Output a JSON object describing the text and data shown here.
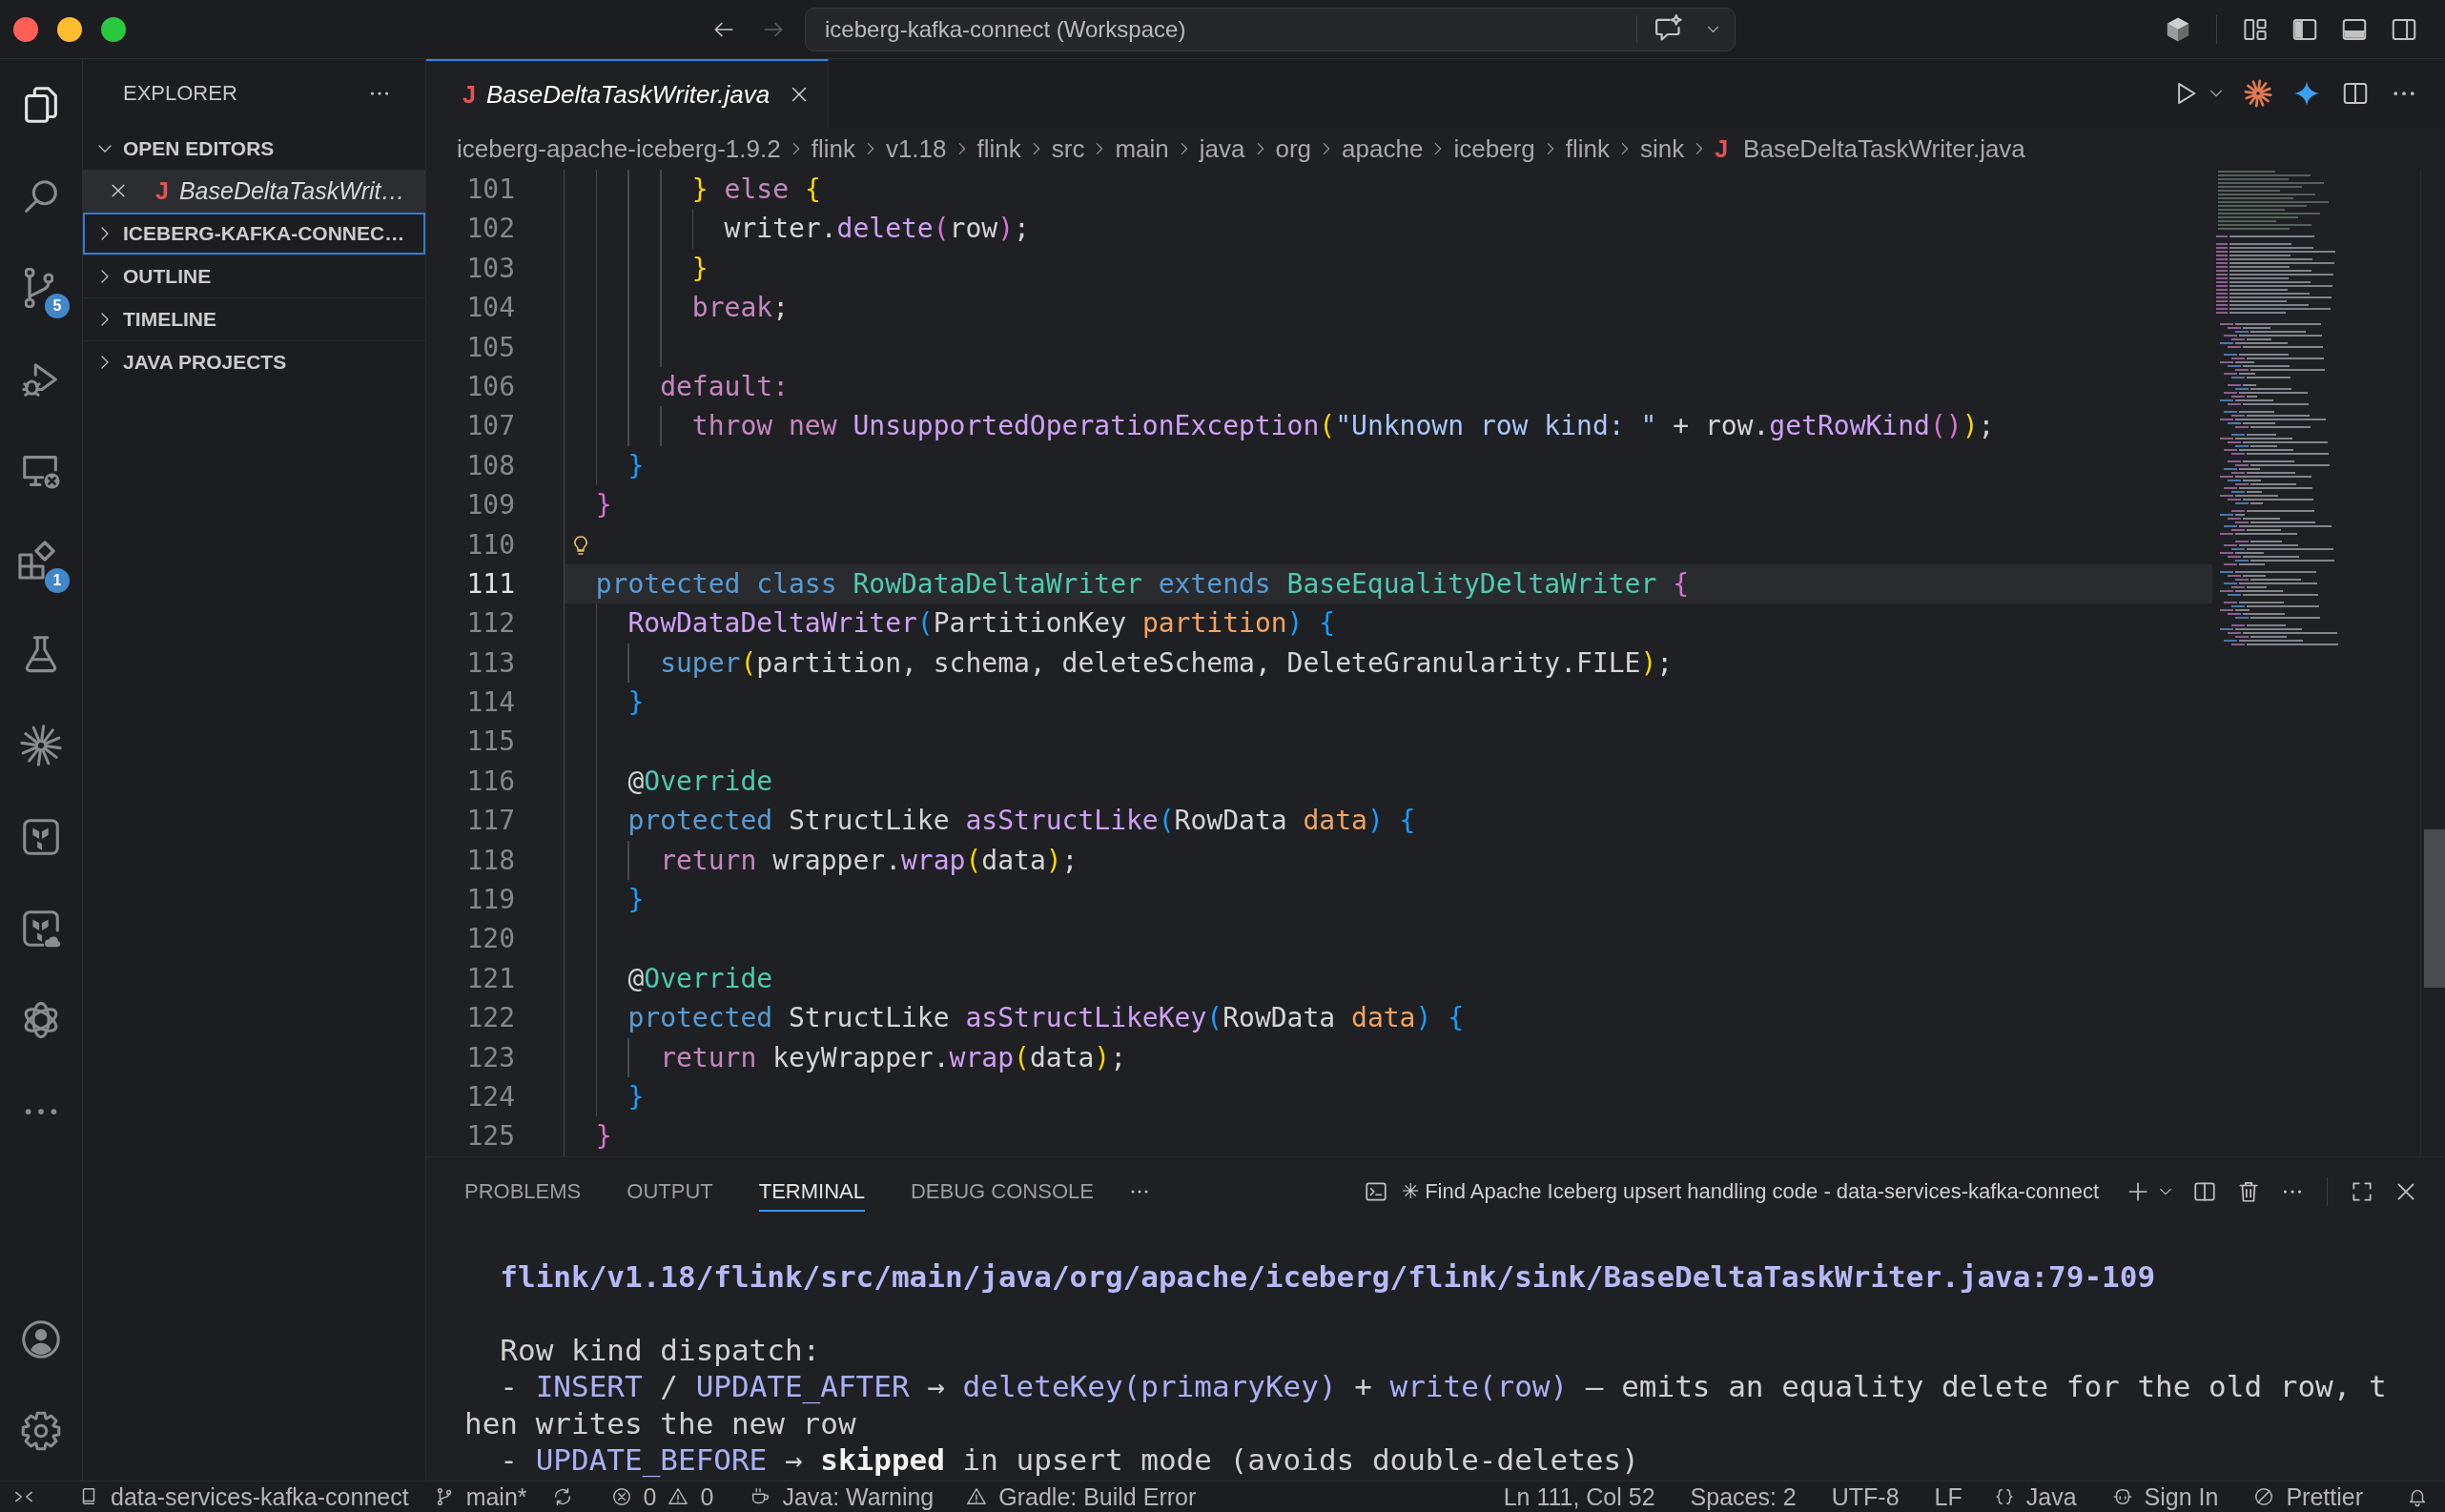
{
  "title_bar": {
    "navigation": {
      "back": {
        "disabled": false
      },
      "forward": {
        "disabled": true
      }
    },
    "command_center": "iceberg-kafka-connect (Workspace)",
    "layout_toggles": [
      {
        "on": true
      },
      {
        "on": true
      },
      {
        "on": false
      }
    ]
  },
  "activity_bar": {
    "items": [
      {
        "selected": true
      },
      {
        "selected": false
      },
      {
        "selected": false,
        "badge": "5"
      },
      {
        "selected": false
      },
      {
        "selected": false
      },
      {
        "selected": false,
        "badge": "1"
      },
      {
        "selected": false
      },
      {
        "selected": false
      },
      {
        "selected": false
      },
      {
        "selected": false
      },
      {
        "selected": false
      }
    ]
  },
  "sidebar": {
    "title": "EXPLORER",
    "sections": [
      {
        "label": "OPEN EDITORS",
        "expanded": true,
        "focused": false,
        "items": [
          {
            "icon": "J",
            "label": "BaseDeltaTaskWrit…",
            "selected": true,
            "preview": true
          }
        ]
      },
      {
        "label": "ICEBERG-KAFKA-CONNEC…",
        "expanded": false,
        "focused": true
      },
      {
        "label": "OUTLINE",
        "expanded": false,
        "focused": false
      },
      {
        "label": "TIMELINE",
        "expanded": false,
        "focused": false
      },
      {
        "label": "JAVA PROJECTS",
        "expanded": false,
        "focused": false
      }
    ]
  },
  "editor": {
    "tabs": [
      {
        "icon": "J",
        "label": "BaseDeltaTaskWriter.java",
        "selected": true,
        "preview": true
      }
    ],
    "breadcrumb": {
      "folders": [
        "iceberg-apache-iceberg-1.9.2",
        "flink",
        "v1.18",
        "flink",
        "src",
        "main",
        "java",
        "org",
        "apache",
        "iceberg",
        "flink",
        "sink"
      ],
      "file": {
        "icon": "J",
        "label": "BaseDeltaTaskWriter.java"
      }
    },
    "lines": [
      {
        "number": "101",
        "current": false,
        "lightbulb": false,
        "tokens": [
          {
            "text": "        }",
            "kind": "bracket1"
          },
          {
            "text": " else ",
            "kind": "control"
          },
          {
            "text": "{",
            "kind": "bracket1"
          }
        ]
      },
      {
        "number": "102",
        "current": false,
        "lightbulb": false,
        "tokens": [
          {
            "text": "          writer.",
            "kind": "plain"
          },
          {
            "text": "delete",
            "kind": "function"
          },
          {
            "text": "(",
            "kind": "bracket2"
          },
          {
            "text": "row",
            "kind": "plain"
          },
          {
            "text": ")",
            "kind": "bracket2"
          },
          {
            "text": ";",
            "kind": "plain"
          }
        ]
      },
      {
        "number": "103",
        "current": false,
        "lightbulb": false,
        "tokens": [
          {
            "text": "        }",
            "kind": "bracket1"
          }
        ]
      },
      {
        "number": "104",
        "current": false,
        "lightbulb": false,
        "tokens": [
          {
            "text": "        break",
            "kind": "control"
          },
          {
            "text": ";",
            "kind": "plain"
          }
        ]
      },
      {
        "number": "105",
        "current": false,
        "lightbulb": false
      },
      {
        "number": "106",
        "current": false,
        "lightbulb": false,
        "tokens": [
          {
            "text": "      default:",
            "kind": "control"
          }
        ]
      },
      {
        "number": "107",
        "current": false,
        "lightbulb": false,
        "tokens": [
          {
            "text": "        throw new ",
            "kind": "control"
          },
          {
            "text": "UnsupportedOperationException",
            "kind": "function"
          },
          {
            "text": "(",
            "kind": "bracket1"
          },
          {
            "text": "\"Unknown row kind: \"",
            "kind": "string"
          },
          {
            "text": " + row.",
            "kind": "plain"
          },
          {
            "text": "getRowKind",
            "kind": "function"
          },
          {
            "text": "()",
            "kind": "bracket2"
          },
          {
            "text": ")",
            "kind": "bracket1"
          },
          {
            "text": ";",
            "kind": "plain"
          }
        ]
      },
      {
        "number": "108",
        "current": false,
        "lightbulb": false,
        "tokens": [
          {
            "text": "    }",
            "kind": "bracket3"
          }
        ]
      },
      {
        "number": "109",
        "current": false,
        "lightbulb": false,
        "tokens": [
          {
            "text": "  }",
            "kind": "bracket2"
          }
        ]
      },
      {
        "number": "110",
        "current": false,
        "lightbulb": true
      },
      {
        "number": "111",
        "current": true,
        "lightbulb": false,
        "tokens": [
          {
            "text": "  protected class ",
            "kind": "keyword"
          },
          {
            "text": "RowDataDeltaWriter",
            "kind": "type"
          },
          {
            "text": " extends ",
            "kind": "keyword"
          },
          {
            "text": "BaseEqualityDeltaWriter",
            "kind": "type"
          },
          {
            "text": " {",
            "kind": "bracket2"
          }
        ]
      },
      {
        "number": "112",
        "current": false,
        "lightbulb": false,
        "tokens": [
          {
            "text": "    RowDataDeltaWriter",
            "kind": "function"
          },
          {
            "text": "(",
            "kind": "bracket3"
          },
          {
            "text": "PartitionKey ",
            "kind": "plain"
          },
          {
            "text": "partition",
            "kind": "param"
          },
          {
            "text": ") {",
            "kind": "bracket3"
          }
        ]
      },
      {
        "number": "113",
        "current": false,
        "lightbulb": false,
        "tokens": [
          {
            "text": "      super",
            "kind": "keyword"
          },
          {
            "text": "(",
            "kind": "bracket1"
          },
          {
            "text": "partition, schema, deleteSchema, DeleteGranularity.FILE",
            "kind": "plain"
          },
          {
            "text": ")",
            "kind": "bracket1"
          },
          {
            "text": ";",
            "kind": "plain"
          }
        ]
      },
      {
        "number": "114",
        "current": false,
        "lightbulb": false,
        "tokens": [
          {
            "text": "    }",
            "kind": "bracket3"
          }
        ]
      },
      {
        "number": "115",
        "current": false,
        "lightbulb": false
      },
      {
        "number": "116",
        "current": false,
        "lightbulb": false,
        "tokens": [
          {
            "text": "    @",
            "kind": "plain"
          },
          {
            "text": "Override",
            "kind": "type"
          }
        ]
      },
      {
        "number": "117",
        "current": false,
        "lightbulb": false,
        "tokens": [
          {
            "text": "    protected ",
            "kind": "keyword"
          },
          {
            "text": "StructLike ",
            "kind": "plain"
          },
          {
            "text": "asStructLike",
            "kind": "function"
          },
          {
            "text": "(",
            "kind": "bracket3"
          },
          {
            "text": "RowData ",
            "kind": "plain"
          },
          {
            "text": "data",
            "kind": "param"
          },
          {
            "text": ") {",
            "kind": "bracket3"
          }
        ]
      },
      {
        "number": "118",
        "current": false,
        "lightbulb": false,
        "tokens": [
          {
            "text": "      return ",
            "kind": "control"
          },
          {
            "text": "wrapper.",
            "kind": "plain"
          },
          {
            "text": "wrap",
            "kind": "function"
          },
          {
            "text": "(",
            "kind": "bracket1"
          },
          {
            "text": "data",
            "kind": "plain"
          },
          {
            "text": ")",
            "kind": "bracket1"
          },
          {
            "text": ";",
            "kind": "plain"
          }
        ]
      },
      {
        "number": "119",
        "current": false,
        "lightbulb": false,
        "tokens": [
          {
            "text": "    }",
            "kind": "bracket3"
          }
        ]
      },
      {
        "number": "120",
        "current": false,
        "lightbulb": false
      },
      {
        "number": "121",
        "current": false,
        "lightbulb": false,
        "tokens": [
          {
            "text": "    @",
            "kind": "plain"
          },
          {
            "text": "Override",
            "kind": "type"
          }
        ]
      },
      {
        "number": "122",
        "current": false,
        "lightbulb": false,
        "tokens": [
          {
            "text": "    protected ",
            "kind": "keyword"
          },
          {
            "text": "StructLike ",
            "kind": "plain"
          },
          {
            "text": "asStructLikeKey",
            "kind": "function"
          },
          {
            "text": "(",
            "kind": "bracket3"
          },
          {
            "text": "RowData ",
            "kind": "plain"
          },
          {
            "text": "data",
            "kind": "param"
          },
          {
            "text": ") {",
            "kind": "bracket3"
          }
        ]
      },
      {
        "number": "123",
        "current": false,
        "lightbulb": false,
        "tokens": [
          {
            "text": "      return ",
            "kind": "control"
          },
          {
            "text": "keyWrapper.",
            "kind": "plain"
          },
          {
            "text": "wrap",
            "kind": "function"
          },
          {
            "text": "(",
            "kind": "bracket1"
          },
          {
            "text": "data",
            "kind": "plain"
          },
          {
            "text": ")",
            "kind": "bracket1"
          },
          {
            "text": ";",
            "kind": "plain"
          }
        ]
      },
      {
        "number": "124",
        "current": false,
        "lightbulb": false,
        "tokens": [
          {
            "text": "    }",
            "kind": "bracket3"
          }
        ]
      },
      {
        "number": "125",
        "current": false,
        "lightbulb": false,
        "tokens": [
          {
            "text": "  }",
            "kind": "bracket2"
          }
        ]
      }
    ]
  },
  "panel": {
    "tabs": [
      {
        "label": "PROBLEMS",
        "selected": false
      },
      {
        "label": "OUTPUT",
        "selected": false
      },
      {
        "label": "TERMINAL",
        "selected": true
      },
      {
        "label": "DEBUG CONSOLE",
        "selected": false
      }
    ],
    "terminal_title": "✳ Find Apache Iceberg upsert handling code - data-services-kafka-connect",
    "paragraphs": [
      {
        "lines": [
          {
            "segments": [
              {
                "text": "  flink/v1.18/flink/src/main/java/org/apache/iceberg/flink/sink/BaseDeltaTaskWriter.java:79-109",
                "kind": "path"
              }
            ]
          }
        ]
      },
      {
        "lines": [
          {
            "segments": [
              {
                "text": "  Row kind dispatch:",
                "kind": "plain"
              }
            ]
          },
          {
            "segments": [
              {
                "text": "  - ",
                "kind": "plain"
              },
              {
                "text": "INSERT",
                "kind": "code"
              },
              {
                "text": " / ",
                "kind": "plain"
              },
              {
                "text": "UPDATE_AFTER",
                "kind": "code"
              },
              {
                "text": " → ",
                "kind": "plain"
              },
              {
                "text": "deleteKey(primaryKey)",
                "kind": "code"
              },
              {
                "text": " + ",
                "kind": "plain"
              },
              {
                "text": "write(row)",
                "kind": "code"
              },
              {
                "text": " — emits an equality delete for the old row, t",
                "kind": "plain"
              }
            ]
          },
          {
            "segments": [
              {
                "text": "hen writes the new row",
                "kind": "plain"
              }
            ]
          },
          {
            "segments": [
              {
                "text": "  - ",
                "kind": "plain"
              },
              {
                "text": "UPDATE_BEFORE",
                "kind": "code"
              },
              {
                "text": " → ",
                "kind": "plain"
              },
              {
                "text": "skipped",
                "kind": "bold"
              },
              {
                "text": " in upsert mode (avoids double-deletes)",
                "kind": "plain"
              }
            ]
          }
        ]
      }
    ]
  },
  "status_bar": {
    "workspace": "data-services-kafka-connect",
    "branch": "main*",
    "errors": "0",
    "warnings": "0",
    "java_status": "Java: Warning",
    "gradle_status": "Gradle: Build Error",
    "cursor_position": "Ln 111, Col 52",
    "indentation": "Spaces: 2",
    "encoding": "UTF-8",
    "line_ending": "LF",
    "language": "Java",
    "account": "Sign In",
    "formatter": "Prettier"
  }
}
